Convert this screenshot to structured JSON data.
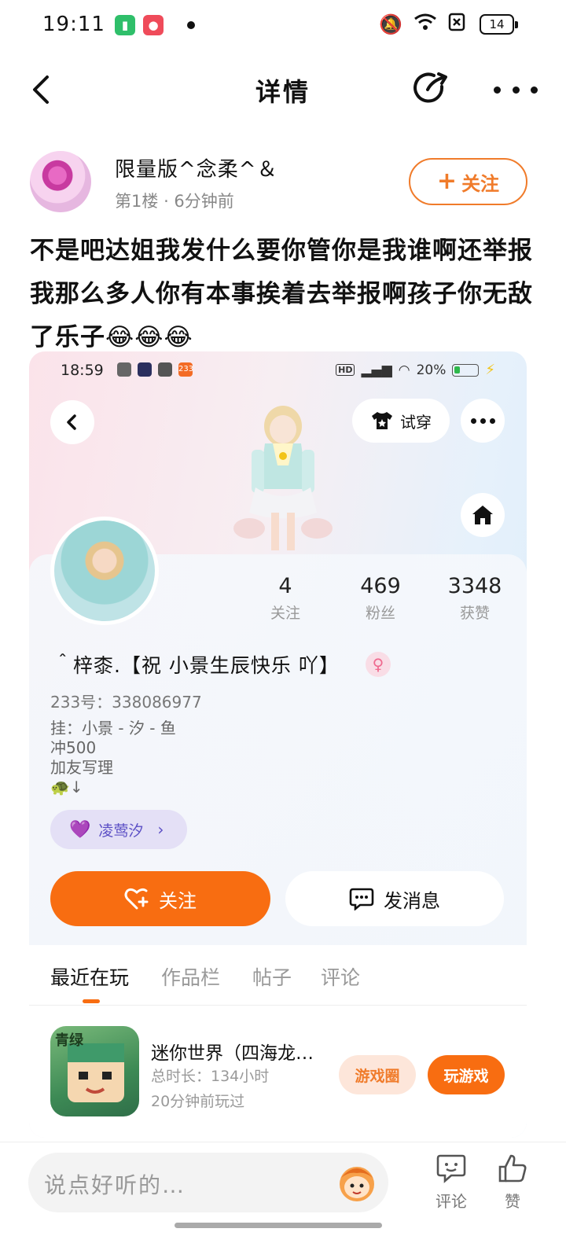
{
  "status_bar": {
    "time": "19:11",
    "battery": "14"
  },
  "header": {
    "title": "详情"
  },
  "post": {
    "author_name": "限量版^念柔^＆",
    "floor": "第1楼",
    "time_ago": "6分钟前",
    "follow_label": "关注",
    "text": "不是吧达姐我发什么要你管你是我谁啊还举报我那么多人你有本事挨着去举报啊孩子你无敌了乐子😂😂😂"
  },
  "screenshot": {
    "status_time": "18:59",
    "status_battery": "20%",
    "try_on_label": "试穿",
    "stats": [
      {
        "num": "4",
        "label": "关注"
      },
      {
        "num": "469",
        "label": "粉丝"
      },
      {
        "num": "3348",
        "label": "获赞"
      }
    ],
    "profile_name": "＾梓桼.【祝 小景生辰快乐 吖】",
    "id_line": "233号：338086977",
    "bio_lines": [
      "挂：小景 - 汐 - 鱼",
      "冲500",
      "加友写理",
      "🐢↓"
    ],
    "bond_name": "凌莺汐",
    "follow_label": "关注",
    "message_label": "发消息",
    "tabs": [
      "最近在玩",
      "作品栏",
      "帖子",
      "评论"
    ],
    "game": {
      "title": "迷你世界（四海龙…",
      "duration": "总时长：134小时",
      "last_played": "20分钟前玩过",
      "circle_label": "游戏圈",
      "play_label": "玩游戏",
      "icon_text": "青绿"
    }
  },
  "bottom_bar": {
    "placeholder": "说点好听的…",
    "comment_label": "评论",
    "like_label": "赞"
  }
}
